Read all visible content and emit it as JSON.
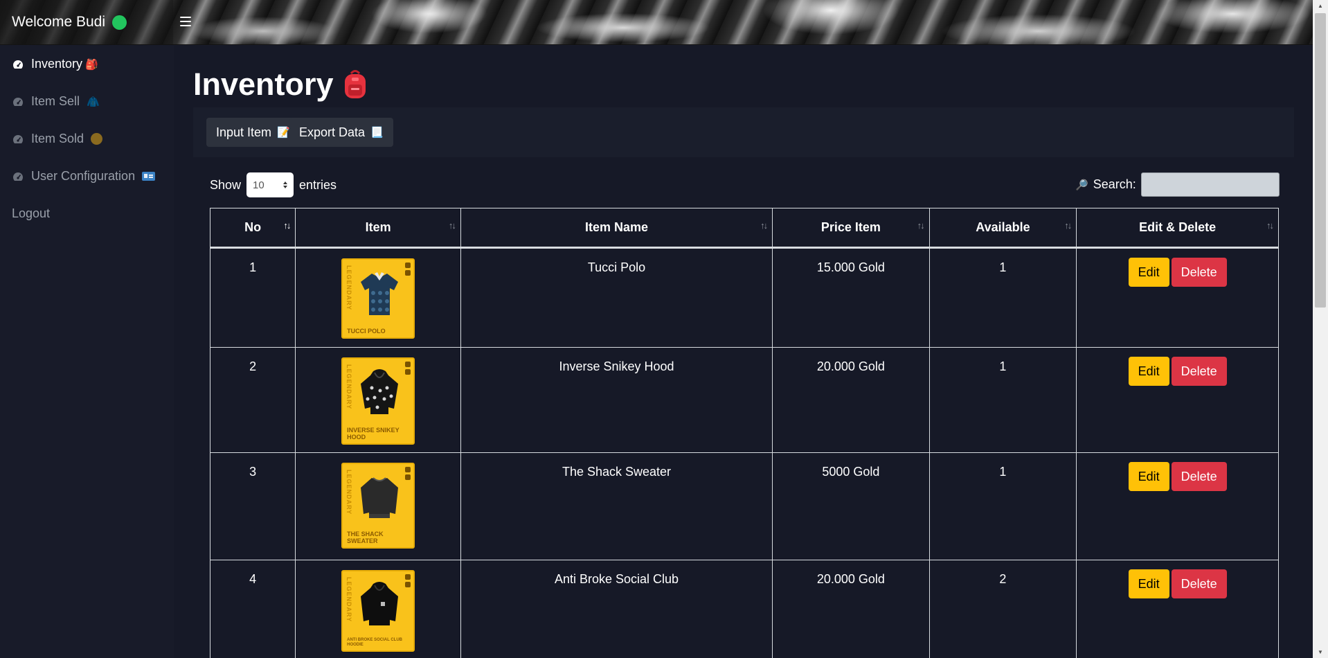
{
  "header": {
    "welcome": "Welcome Budi",
    "online_color": "#22c55e"
  },
  "sidebar": {
    "items": [
      {
        "label": "Inventory",
        "icon": "gauge-icon",
        "emoji": "🎒",
        "active": true
      },
      {
        "label": "Item Sell",
        "icon": "gauge-icon",
        "emoji": "🧥",
        "active": false
      },
      {
        "label": "Item Sold",
        "icon": "gauge-icon",
        "emoji": "🟤",
        "active": false
      },
      {
        "label": "User Configuration",
        "icon": "gauge-icon",
        "emoji": "🪪",
        "active": false
      }
    ],
    "logout": "Logout"
  },
  "main": {
    "title": "Inventory",
    "title_emoji": "🎒",
    "toolbar": {
      "input_item": "Input Item",
      "input_item_emoji": "📝",
      "export_data": "Export Data",
      "export_data_emoji": "📃"
    },
    "show_label": "Show",
    "entries_value": "10",
    "entries_label": "entries",
    "search_label": "Search:",
    "search_emoji": "🔎"
  },
  "table": {
    "headers": [
      "No",
      "Item",
      "Item Name",
      "Price Item",
      "Available",
      "Edit & Delete"
    ],
    "rows": [
      {
        "no": "1",
        "card_label": "TUCCI POLO",
        "rarity": "LEGENDARY",
        "name": "Tucci Polo",
        "price": "15.000 Gold",
        "available": "1",
        "edit": "Edit",
        "delete": "Delete"
      },
      {
        "no": "2",
        "card_label": "INVERSE SNIKEY HOOD",
        "rarity": "LEGENDARY",
        "name": "Inverse Snikey Hood",
        "price": "20.000 Gold",
        "available": "1",
        "edit": "Edit",
        "delete": "Delete"
      },
      {
        "no": "3",
        "card_label": "THE SHACK SWEATER",
        "rarity": "LEGENDARY",
        "name": "The Shack Sweater",
        "price": "5000 Gold",
        "available": "1",
        "edit": "Edit",
        "delete": "Delete"
      },
      {
        "no": "4",
        "card_label": "ANTI BROKE SOCIAL CLUB HOODIE",
        "rarity": "LEGENDARY",
        "name": "Anti Broke Social Club",
        "price": "20.000 Gold",
        "available": "2",
        "edit": "Edit",
        "delete": "Delete"
      }
    ]
  },
  "colors": {
    "background": "#161927",
    "edit_button": "#ffc107",
    "delete_button": "#dc3545",
    "card": "#f9c21b"
  }
}
